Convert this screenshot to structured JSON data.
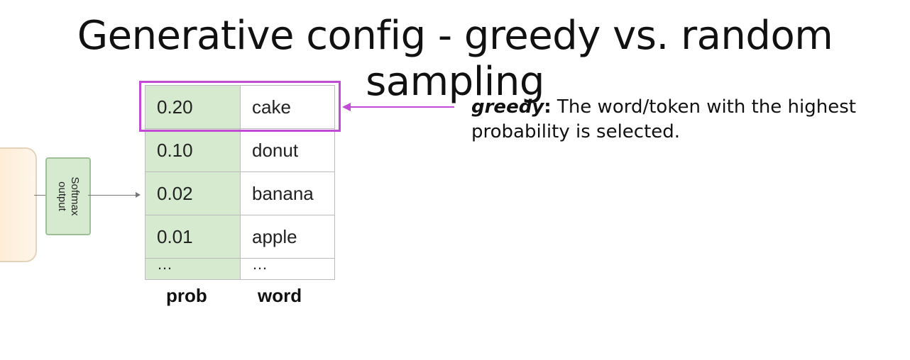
{
  "title": "Generative config - greedy vs. random sampling",
  "softmax": {
    "label": "Softmax\noutput"
  },
  "table": {
    "rows": [
      {
        "prob": "0.20",
        "word": "cake"
      },
      {
        "prob": "0.10",
        "word": "donut"
      },
      {
        "prob": "0.02",
        "word": "banana"
      },
      {
        "prob": "0.01",
        "word": "apple"
      },
      {
        "prob": "…",
        "word": "…"
      }
    ],
    "column_labels": {
      "prob": "prob",
      "word": "word"
    }
  },
  "description": {
    "term": "greedy",
    "colon": ":",
    "text": " The word/token with the highest probability is selected."
  },
  "colors": {
    "highlight": "#c14bd4",
    "prob_fill": "#d6ead0",
    "softmax_fill": "#d6ead0",
    "model_fill": "#fde9cf"
  }
}
